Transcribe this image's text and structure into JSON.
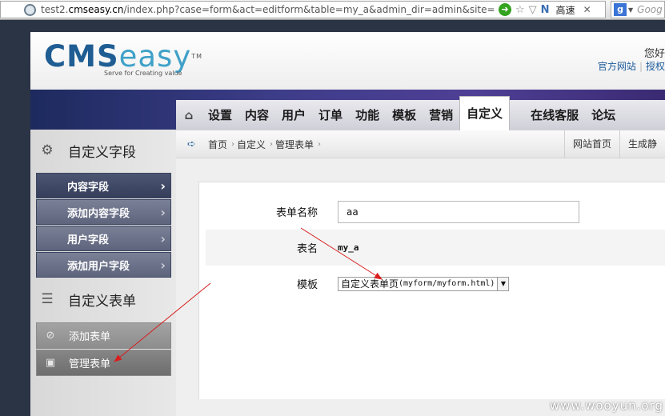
{
  "browser": {
    "url_prefix": "test2.",
    "url_host": "cmseasy.cn",
    "url_path": "/index.php?case=form&act=editform&table=my_a&admin_dir=admin&site=defa",
    "speed_label": "高速",
    "search_placeholder": "Goog"
  },
  "header": {
    "logo_cms": "CMS",
    "logo_easy": "easy",
    "logo_tm": "TM",
    "logo_tagline": "Serve for Creating value",
    "greeting": "您好",
    "links": [
      "官方网站",
      "授权"
    ]
  },
  "nav": {
    "items": [
      "设置",
      "内容",
      "用户",
      "订单",
      "功能",
      "模板",
      "营销",
      "自定义",
      "在线客服",
      "论坛"
    ],
    "active_index": 7
  },
  "sidebar": {
    "section1_title": "自定义字段",
    "section1_items": [
      "内容字段",
      "添加内容字段",
      "用户字段",
      "添加用户字段"
    ],
    "section2_title": "自定义表单",
    "section2_items": [
      "添加表单",
      "管理表单"
    ]
  },
  "breadcrumb": {
    "items": [
      "首页",
      "自定义",
      "管理表单"
    ],
    "right_buttons": [
      "网站首页",
      "生成静"
    ]
  },
  "form": {
    "name_label": "表单名称",
    "name_value": "aa",
    "table_label": "表名",
    "table_value": "my_a",
    "template_label": "模板",
    "template_value_cn": "自定义表单页",
    "template_value_path": "(myform/myform.html)"
  },
  "watermark": "www.wooyun.org",
  "colors": {
    "annotation_arrow": "#d81e1e",
    "nav_band": "#3e3d8a",
    "link": "#1b5a9a"
  }
}
